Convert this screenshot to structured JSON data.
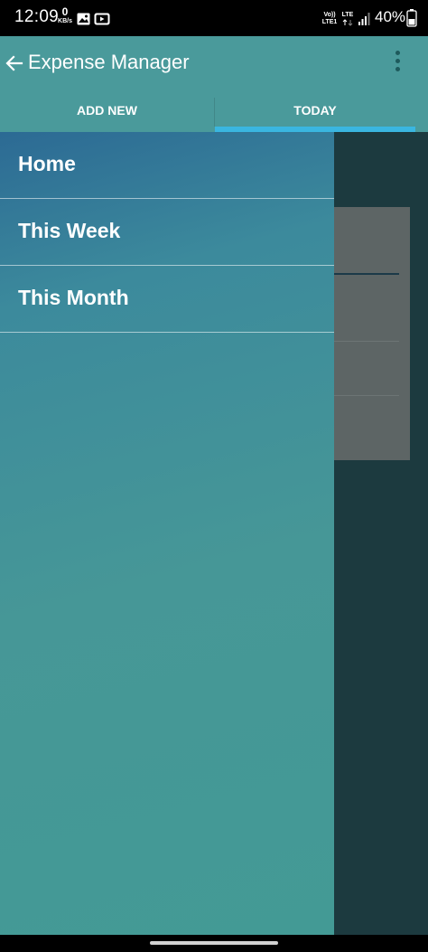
{
  "status_bar": {
    "time": "12:09",
    "net_speed_value": "0",
    "net_speed_unit": "KB/s",
    "volte_label": "Vo))",
    "lte1_label": "LTE1",
    "lte_label": "LTE",
    "battery_percent": "40%",
    "icons": [
      "gallery-icon",
      "youtube-icon",
      "signal-icon",
      "battery-icon"
    ]
  },
  "app_bar": {
    "title": "Expense Manager",
    "back_icon": "arrow-back-icon",
    "menu_icon": "more-vert-icon"
  },
  "tabs": [
    {
      "label": "ADD NEW",
      "selected": false
    },
    {
      "label": "TODAY",
      "selected": true
    }
  ],
  "drawer": {
    "items": [
      {
        "label": "Home"
      },
      {
        "label": "This Week"
      },
      {
        "label": "This Month"
      }
    ]
  },
  "colors": {
    "app_bar": "#4a9a9b",
    "tab_indicator": "#3ab6e0",
    "drawer_top": "#2c6a94",
    "drawer_bottom": "#439a95",
    "scrim": "#1c3a3f"
  }
}
